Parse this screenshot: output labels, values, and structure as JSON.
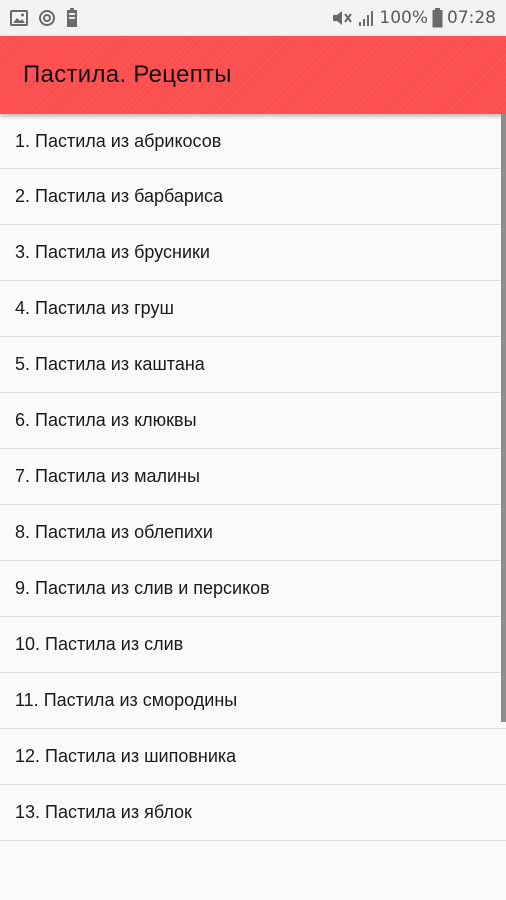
{
  "status_bar": {
    "battery": "100%",
    "time": "07:28",
    "icons": [
      "gallery-icon",
      "sync-icon",
      "battery-small-icon",
      "mute-icon",
      "signal-icon",
      "battery-icon"
    ]
  },
  "app_bar": {
    "title": "Пастила. Рецепты",
    "color": "#ff5252"
  },
  "recipes": [
    "1. Пастила из абрикосов",
    "2. Пастила из барбариса",
    "3. Пастила из брусники",
    "4. Пастила из груш",
    "5. Пастила из каштана",
    "6. Пастила из клюквы",
    "7. Пастила из малины",
    "8. Пастила из облепихи",
    "9. Пастила из слив и персиков",
    "10. Пастила из слив",
    "11. Пастила из смородины",
    "12. Пастила из шиповника",
    "13. Пастила из яблок"
  ]
}
